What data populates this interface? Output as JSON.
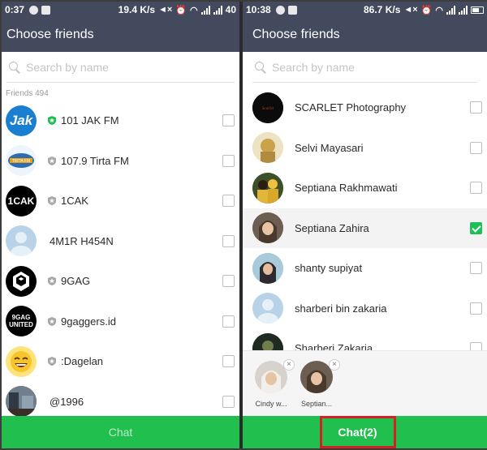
{
  "left": {
    "status": {
      "time": "0:37",
      "net_speed": "19.4 K/s",
      "battery": "40"
    },
    "title": "Choose friends",
    "search": {
      "placeholder": "Search by name"
    },
    "section_label": "Friends 494",
    "friends": [
      {
        "name": "101 JAK FM",
        "avatar": "jak-fm-logo",
        "official": true,
        "badge_color": "#1fbf57"
      },
      {
        "name": "107.9 Tirta FM",
        "avatar": "tirta-fm-logo",
        "official": true,
        "badge_color": "#a8a8a8"
      },
      {
        "name": "1CAK",
        "avatar": "1cak-logo",
        "official": true,
        "badge_color": "#a8a8a8"
      },
      {
        "name": "4M1R H454N",
        "avatar": "default-profile",
        "official": false
      },
      {
        "name": "9GAG",
        "avatar": "9gag-logo",
        "official": true,
        "badge_color": "#a8a8a8"
      },
      {
        "name": "9gaggers.id",
        "avatar": "9gag-united-logo",
        "official": true,
        "badge_color": "#a8a8a8"
      },
      {
        "name": ":Dagelan",
        "avatar": "dagelan-emoji",
        "official": true,
        "badge_color": "#a8a8a8"
      },
      {
        "name": "@1996",
        "avatar": "photo",
        "official": false
      }
    ],
    "chat_button": "Chat"
  },
  "right": {
    "status": {
      "time": "10:38",
      "net_speed": "86.7 K/s",
      "battery": ""
    },
    "title": "Choose friends",
    "search": {
      "placeholder": "Search by name"
    },
    "friends": [
      {
        "name": "SCARLET Photography",
        "checked": false
      },
      {
        "name": "Selvi Mayasari",
        "checked": false
      },
      {
        "name": "Septiana Rakhmawati",
        "checked": false
      },
      {
        "name": "Septiana Zahira",
        "checked": true
      },
      {
        "name": "shanty supiyat",
        "checked": false
      },
      {
        "name": "sharberi bin zakaria",
        "checked": false
      },
      {
        "name": "Sharberi Zakaria",
        "checked": false
      }
    ],
    "selected": [
      {
        "label": "Cindy w..."
      },
      {
        "label": "Septian..."
      }
    ],
    "chat_button": "Chat(2)"
  },
  "colors": {
    "header": "#434a5e",
    "accent_green": "#21c04e",
    "highlight_border": "#d42020"
  }
}
